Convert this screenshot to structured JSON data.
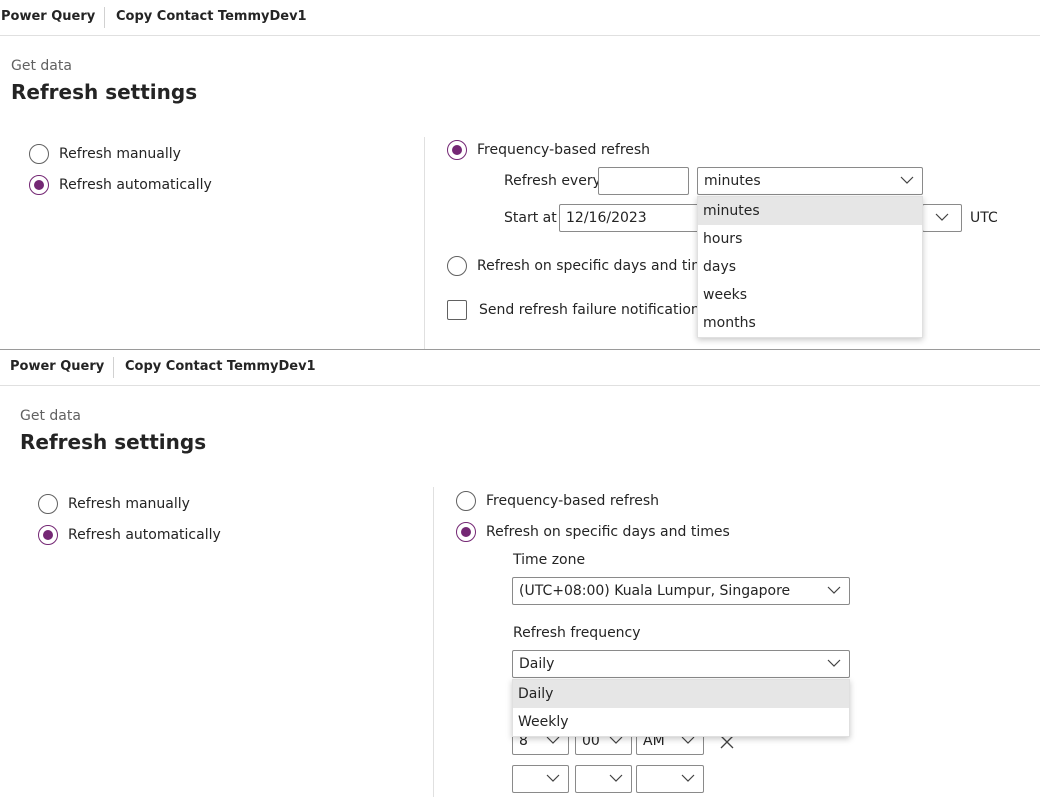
{
  "top": {
    "breadcrumb": {
      "app": "Power Query",
      "dataflow": "Copy Contact TemmyDev1"
    },
    "subtitle": "Get data",
    "title": "Refresh settings",
    "refresh_options": {
      "manual": "Refresh manually",
      "auto": "Refresh automatically",
      "selected": "auto"
    },
    "frequency": {
      "freq_label": "Frequency-based refresh",
      "refresh_every_label": "Refresh every",
      "refresh_every_value": "",
      "unit_selected": "minutes",
      "unit_options": [
        "minutes",
        "hours",
        "days",
        "weeks",
        "months"
      ],
      "start_at_label": "Start at",
      "start_at_date": "12/16/2023",
      "utc_label": "UTC",
      "specific_label": "Refresh on specific days and times",
      "notify_label": "Send refresh failure notification to"
    }
  },
  "bottom": {
    "breadcrumb": {
      "app": "Power Query",
      "dataflow": "Copy Contact TemmyDev1"
    },
    "subtitle": "Get data",
    "title": "Refresh settings",
    "refresh_options": {
      "manual": "Refresh manually",
      "auto": "Refresh automatically",
      "selected": "auto"
    },
    "schedule": {
      "freq_label": "Frequency-based refresh",
      "specific_label": "Refresh on specific days and times",
      "selected": "specific",
      "time_zone_label": "Time zone",
      "time_zone_value": "(UTC+08:00) Kuala Lumpur, Singapore",
      "refresh_frequency_label": "Refresh frequency",
      "refresh_frequency_value": "Daily",
      "frequency_options": [
        "Daily",
        "Weekly"
      ],
      "time_hour": "8",
      "time_minute": "00",
      "time_ampm": "AM"
    }
  },
  "colors": {
    "accent": "#742774",
    "border": "#8a8a8a",
    "highlight": "#e6e6e6"
  },
  "icons": [
    "chevron-down-icon",
    "close-icon"
  ]
}
